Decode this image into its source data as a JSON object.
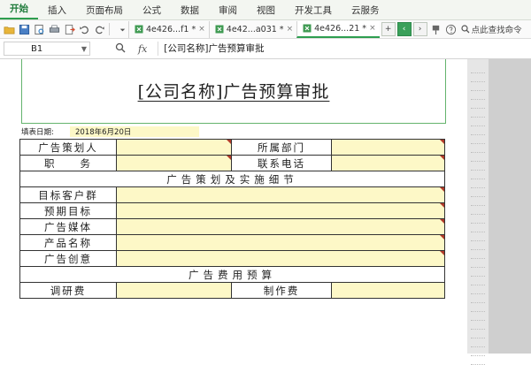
{
  "menu": [
    "开始",
    "插入",
    "页面布局",
    "公式",
    "数据",
    "审阅",
    "视图",
    "开发工具",
    "云服务"
  ],
  "tabs": [
    {
      "label": "4e426...f1 *"
    },
    {
      "label": "4e42...a031 *"
    },
    {
      "label": "4e426...21 *"
    }
  ],
  "toolbar": {
    "search_label": "点此查找命令",
    "close_glyph": "×"
  },
  "formula_bar": {
    "cell_ref": "B1",
    "fx_label": "fx",
    "content": "[公司名称]广告预算审批"
  },
  "sheet": {
    "title": "[公司名称]广告预算审批",
    "date_label": "填表日期:",
    "date_value": "2018年6月20日",
    "rows": {
      "planner": "广告策划人",
      "department": "所属部门",
      "position": "职　　务",
      "phone": "联系电话",
      "section1": "广告策划及实施细节",
      "target_customer": "目标客户群",
      "expected_goal": "预期目标",
      "media": "广告媒体",
      "product_name": "产品名称",
      "creative": "广告创意",
      "section2": "广告费用预算",
      "research_fee": "调研费",
      "production_fee": "制作费"
    }
  },
  "colors": {
    "accent_green": "#2e9e4f",
    "fill_yellow": "#fdf8c7",
    "comment_red": "#b23a2a"
  }
}
